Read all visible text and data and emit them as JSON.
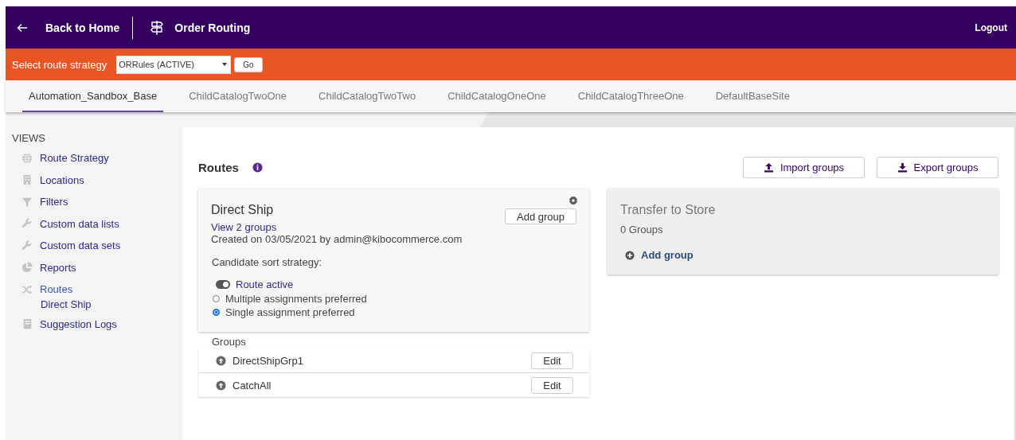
{
  "header": {
    "back": "Back to Home",
    "title": "Order Routing",
    "logout": "Logout"
  },
  "strategy_bar": {
    "label": "Select route strategy",
    "value": "ORRules (ACTIVE)",
    "button": "Go"
  },
  "tabs": [
    {
      "label": "Automation_Sandbox_Base",
      "selected": true
    },
    {
      "label": "ChildCatalogTwoOne",
      "selected": false
    },
    {
      "label": "ChildCatalogTwoTwo",
      "selected": false
    },
    {
      "label": "ChildCatalogOneOne",
      "selected": false
    },
    {
      "label": "ChildCatalogThreeOne",
      "selected": false
    },
    {
      "label": "DefaultBaseSite",
      "selected": false
    }
  ],
  "sidebar": {
    "heading": "VIEWS",
    "items": [
      {
        "label": "Route Strategy",
        "selected": false
      },
      {
        "label": "Locations",
        "selected": false
      },
      {
        "label": "Filters",
        "selected": false
      },
      {
        "label": "Custom data lists",
        "selected": false
      },
      {
        "label": "Custom data sets",
        "selected": false
      },
      {
        "label": "Reports",
        "selected": false
      },
      {
        "label": "Routes",
        "selected": true,
        "children": [
          {
            "label": "Direct Ship",
            "selected": false
          }
        ]
      },
      {
        "label": "Suggestion Logs",
        "selected": false
      }
    ]
  },
  "routes": {
    "title": "Routes",
    "import": "Import groups",
    "export": "Export groups",
    "cards": [
      {
        "kind": "detail",
        "title": "Direct Ship",
        "add_button": "Add group",
        "link": "View 2 groups",
        "created": "Created on 03/05/2021 by admin@kibocommerce.com",
        "sort_label": "Candidate sort strategy:",
        "toggle": {
          "label": "Route active",
          "on": true
        },
        "options": [
          {
            "label": "Multiple assignments preferred",
            "selected": false
          },
          {
            "label": "Single assignment preferred",
            "selected": true
          }
        ],
        "groups_label": "Groups",
        "groups": [
          {
            "name": "DirectShipGrp1",
            "button": "Edit"
          },
          {
            "name": "CatchAll",
            "button": "Edit"
          }
        ]
      },
      {
        "kind": "summary",
        "title": "Transfer to Store",
        "count": "0 Groups",
        "add_link": "Add group"
      }
    ]
  }
}
